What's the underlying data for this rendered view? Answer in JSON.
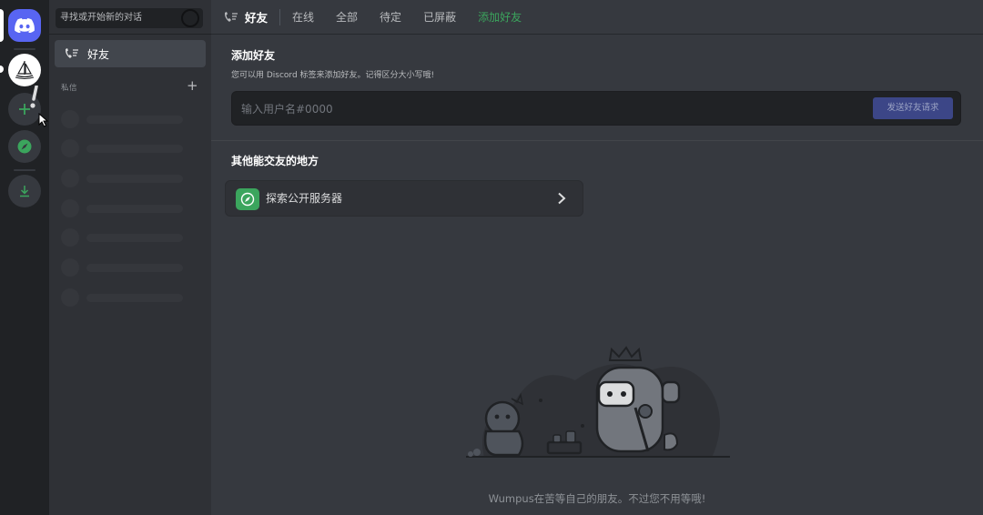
{
  "app": {
    "name": "Discord"
  },
  "colors": {
    "brand": "#5865f2",
    "green": "#3ba55d",
    "rail_bg": "#202225",
    "sidebar_bg": "#2f3136",
    "main_bg": "#36393f",
    "selected_item": "#42464d",
    "send_button": "#3c4687"
  },
  "rail": {
    "items": [
      {
        "icon": "discord-logo-icon",
        "role": "home"
      },
      {
        "icon": "sailboat-icon",
        "role": "server"
      },
      {
        "icon": "plus-icon",
        "role": "add-server"
      },
      {
        "icon": "compass-icon",
        "role": "explore"
      },
      {
        "icon": "download-icon",
        "role": "download-apps"
      }
    ]
  },
  "sidebar": {
    "search_placeholder": "寻找或开始新的对话",
    "friends_label": "好友",
    "dm_title": "私信",
    "dm_add": "+",
    "skeleton_rows": 7
  },
  "topbar": {
    "title": "好友",
    "tabs": [
      {
        "label": "在线",
        "active": false
      },
      {
        "label": "全部",
        "active": false
      },
      {
        "label": "待定",
        "active": false
      },
      {
        "label": "已屏蔽",
        "active": false
      },
      {
        "label": "添加好友",
        "active": true
      }
    ]
  },
  "add_friend": {
    "title": "添加好友",
    "description": "您可以用 Discord 标签来添加好友。记得区分大小写哦!",
    "input_placeholder": "输入用户名#0000",
    "send_button": "发送好友请求"
  },
  "other_places": {
    "title": "其他能交友的地方",
    "explore_label": "探索公开服务器",
    "explore_icon": "compass-icon"
  },
  "empty_state": {
    "text": "Wumpus在苦等自己的朋友。不过您不用等哦!"
  }
}
